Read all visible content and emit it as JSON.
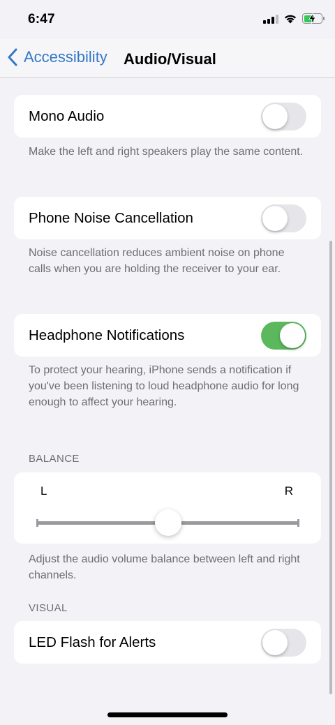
{
  "status_bar": {
    "time": "6:47",
    "icons": [
      "cellular-signal-icon",
      "wifi-icon",
      "battery-charging-icon"
    ]
  },
  "nav": {
    "back_label": "Accessibility",
    "title": "Audio/Visual"
  },
  "settings": {
    "mono_audio": {
      "label": "Mono Audio",
      "on": false,
      "footnote": "Make the left and right speakers play the same content."
    },
    "noise_cancellation": {
      "label": "Phone Noise Cancellation",
      "on": false,
      "footnote": "Noise cancellation reduces ambient noise on phone calls when you are holding the receiver to your ear."
    },
    "headphone_notifications": {
      "label": "Headphone Notifications",
      "on": true,
      "footnote": "To protect your hearing, iPhone sends a notification if you've been listening to loud headphone audio for long enough to affect your hearing."
    }
  },
  "balance": {
    "header": "BALANCE",
    "left_label": "L",
    "right_label": "R",
    "value": 0.5,
    "footnote": "Adjust the audio volume balance between left and right channels."
  },
  "visual": {
    "header": "VISUAL",
    "led_flash": {
      "label": "LED Flash for Alerts",
      "on": false
    }
  },
  "colors": {
    "accent": "#3478c6",
    "toggle_on": "#5cb85c",
    "toggle_off": "#e5e5ea",
    "background": "#f2f2f7"
  }
}
